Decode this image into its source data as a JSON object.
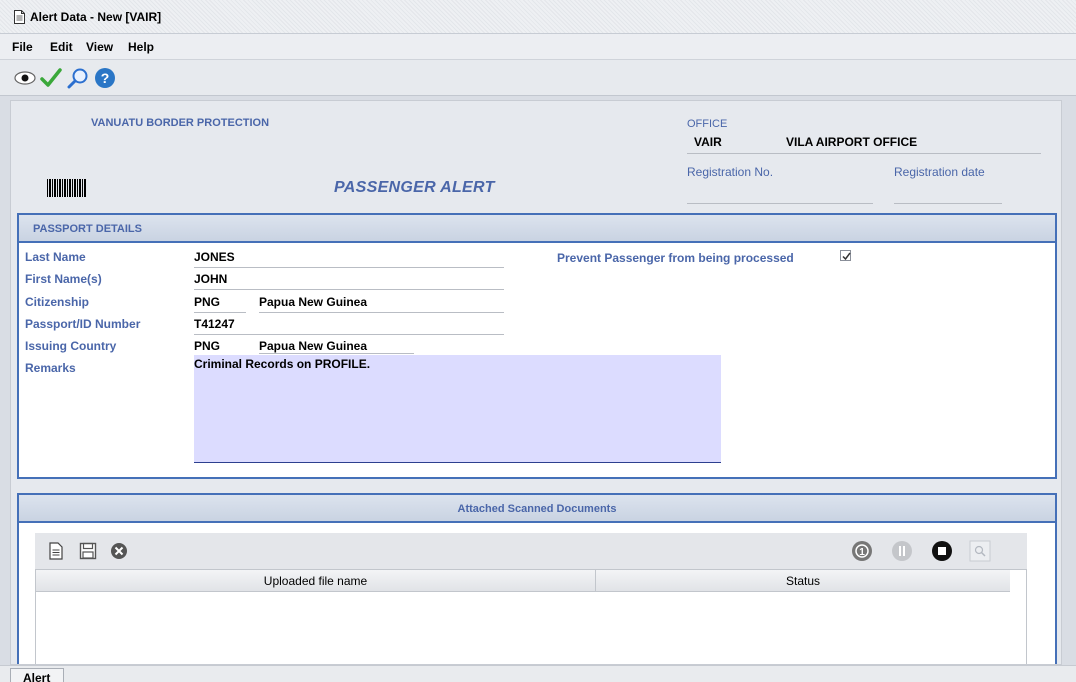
{
  "window": {
    "title": "Alert Data - New [VAIR]"
  },
  "menu": {
    "file": "File",
    "edit": "Edit",
    "view": "View",
    "help": "Help"
  },
  "header": {
    "organization": "VANUATU BORDER PROTECTION",
    "office_label": "OFFICE",
    "office_code": "VAIR",
    "office_name": "VILA AIRPORT OFFICE",
    "registration_no_label": "Registration No.",
    "registration_date_label": "Registration date",
    "form_title": "PASSENGER ALERT"
  },
  "passport": {
    "section_title": "PASSPORT DETAILS",
    "last_name_label": "Last Name",
    "last_name": "JONES",
    "first_name_label": "First Name(s)",
    "first_name": "JOHN",
    "citizenship_label": "Citizenship",
    "citizenship_code": "PNG",
    "citizenship_name": "Papua New Guinea",
    "passport_label": "Passport/ID Number",
    "passport_number": "T41247",
    "issuing_label": "Issuing Country",
    "issuing_code": "PNG",
    "issuing_name": "Papua New Guinea",
    "remarks_label": "Remarks",
    "remarks": "Criminal Records on PROFILE.",
    "prevent_label": "Prevent Passenger from being processed",
    "prevent_checked": true
  },
  "documents": {
    "section_title": "Attached Scanned Documents",
    "columns": [
      "Uploaded file name",
      "Status"
    ]
  },
  "statusbar": {
    "tab": "Alert"
  },
  "colors": {
    "accent": "#4570b8",
    "label": "#4a66a9",
    "remarks_bg": "#dcdcff"
  }
}
